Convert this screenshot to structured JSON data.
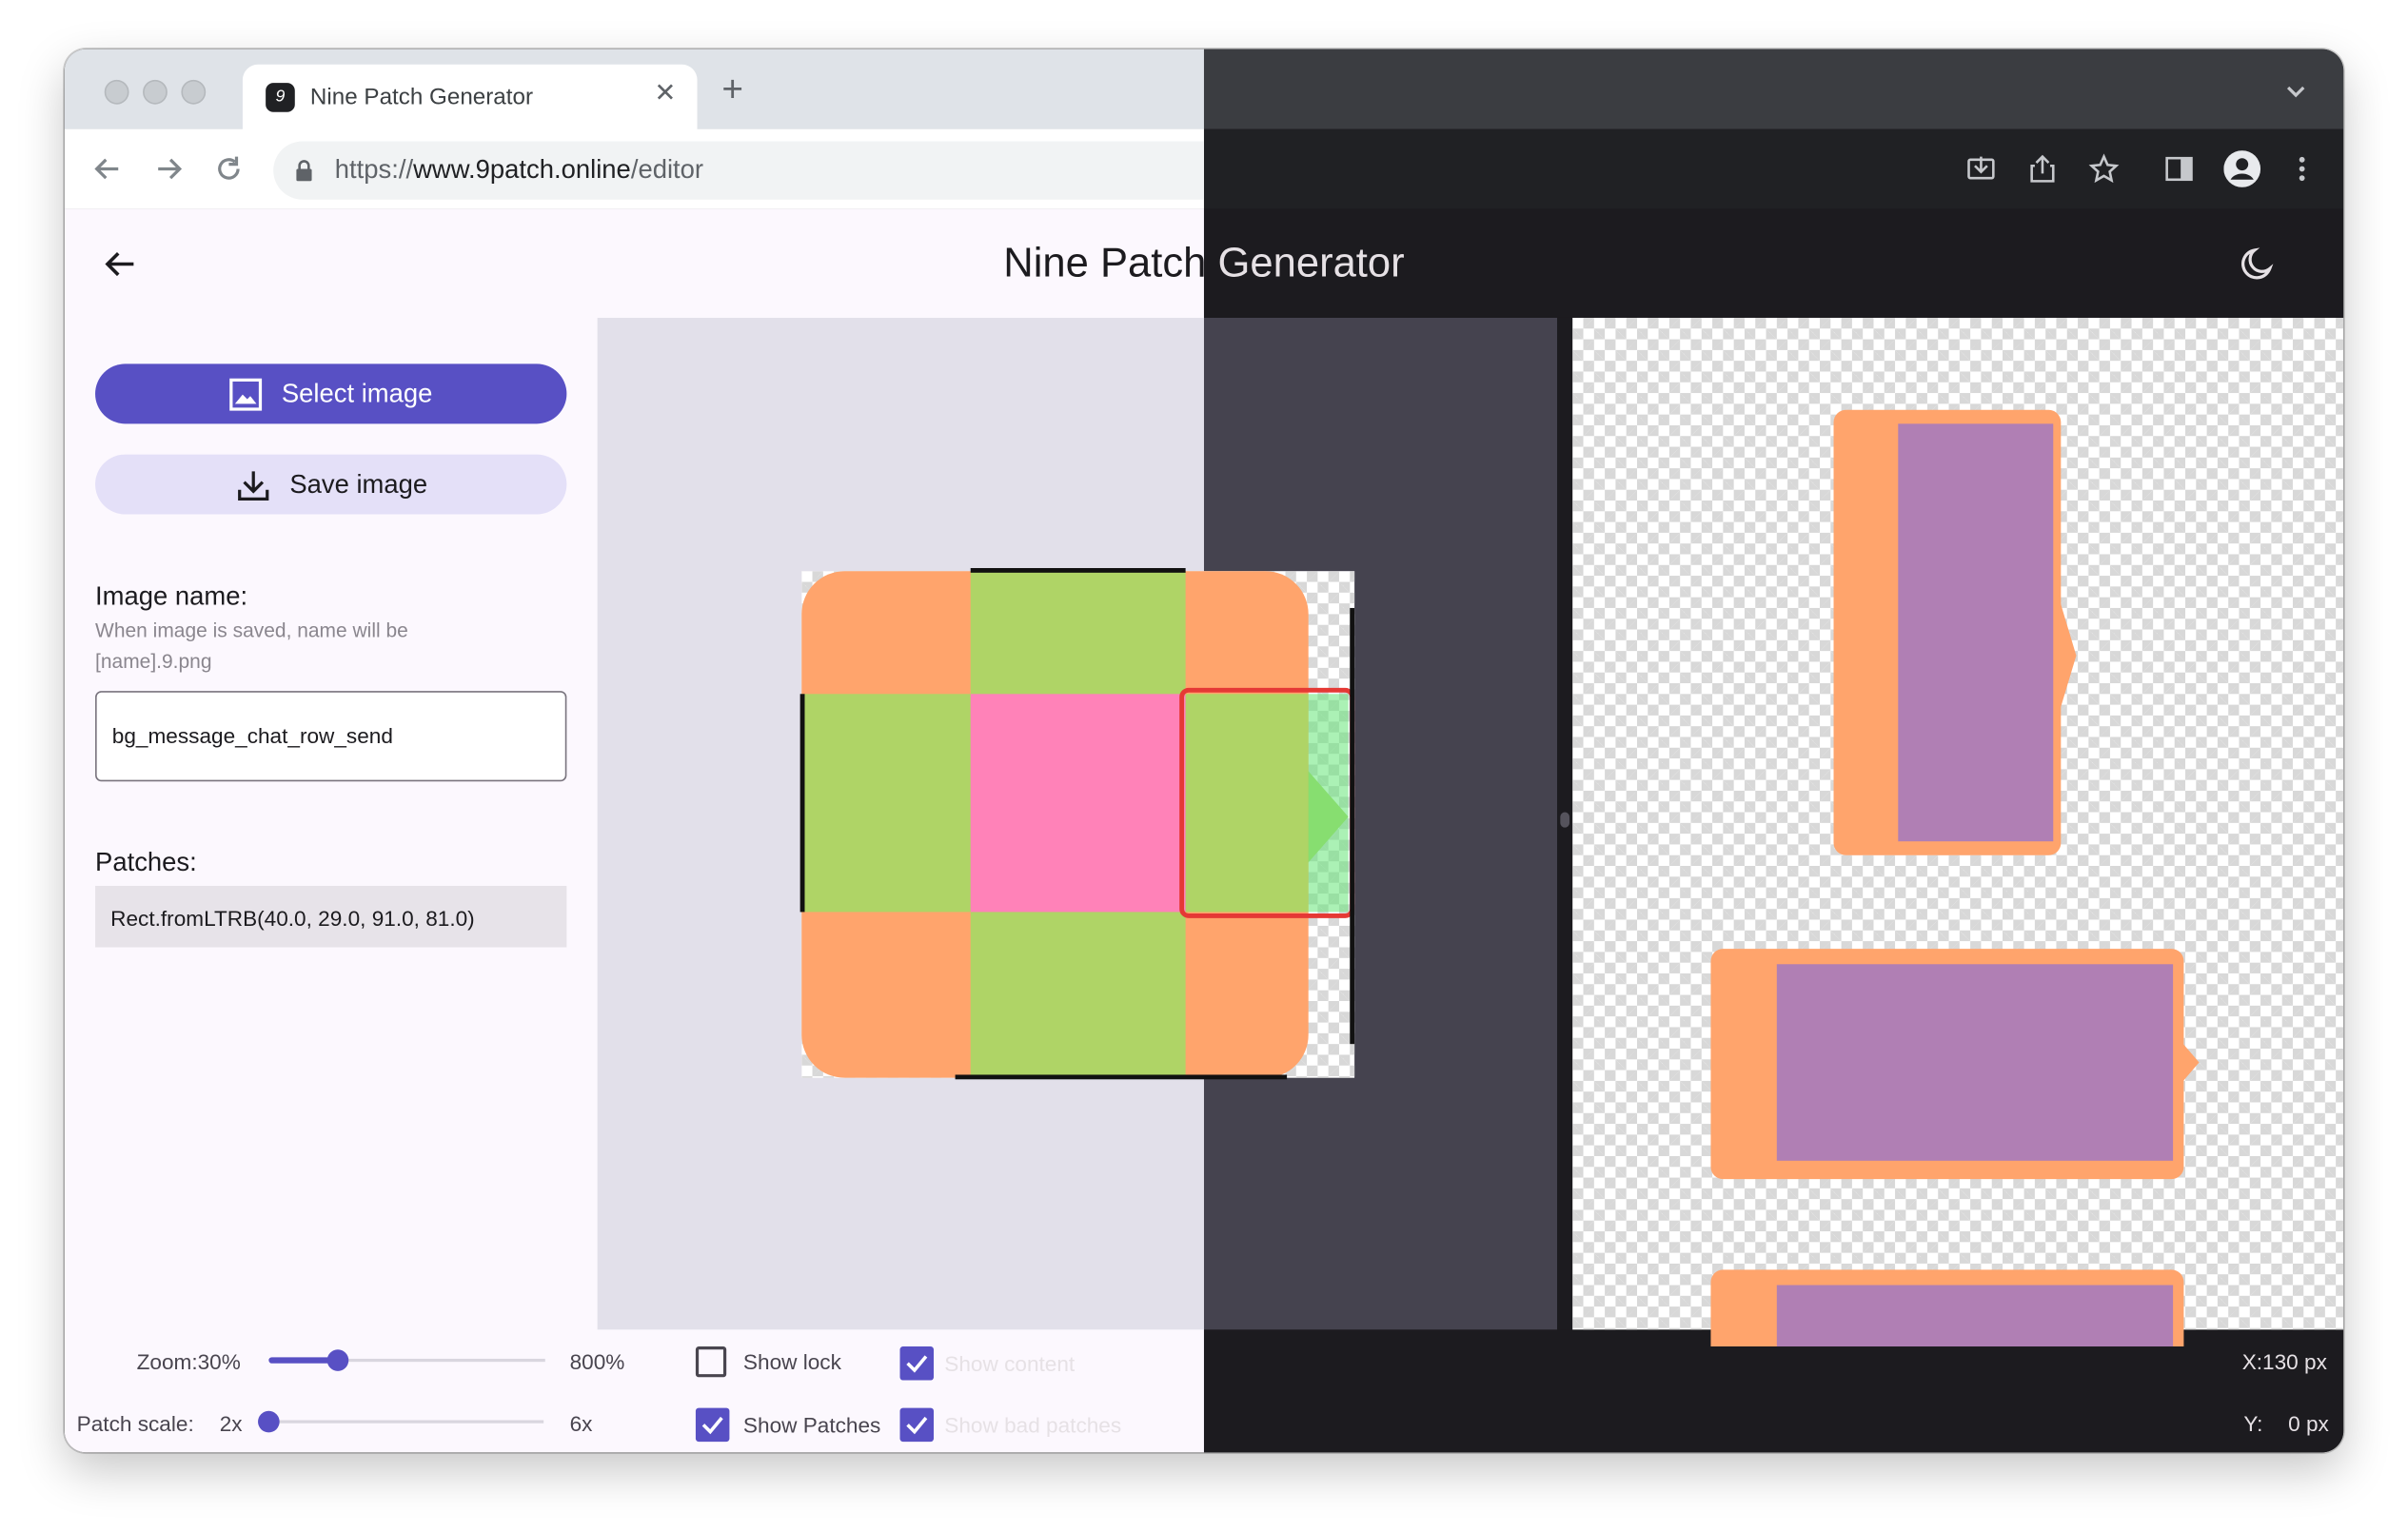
{
  "browser": {
    "tab_title": "Nine Patch Generator",
    "tab_favicon": "9",
    "url_scheme": "https://",
    "url_host": "www.9patch.online",
    "url_path": "/editor"
  },
  "app": {
    "title": "Nine Patch Generator",
    "theme_toggle_icon": "moon-icon"
  },
  "sidebar": {
    "select_image_label": "Select image",
    "save_image_label": "Save image",
    "image_name_label": "Image name:",
    "image_name_hint": "When image is saved, name will be [name].9.png",
    "image_name_value": "bg_message_chat_row_send",
    "patches_label": "Patches:",
    "patches_value": "Rect.fromLTRB(40.0, 29.0, 91.0, 81.0)"
  },
  "controls": {
    "zoom_label": "Zoom:30%",
    "zoom_max_label": "800%",
    "zoom_fraction": 0.25,
    "patch_scale_label": "Patch scale:",
    "patch_scale_value": "2x",
    "patch_scale_max": "6x",
    "patch_scale_fraction": 0.0,
    "show_lock_label": "Show lock",
    "show_lock_checked": false,
    "show_content_label": "Show content",
    "show_content_checked": true,
    "show_patches_label": "Show Patches",
    "show_patches_checked": true,
    "show_bad_patches_label": "Show bad patches",
    "show_bad_patches_checked": true
  },
  "status": {
    "x_label": "X:130 px",
    "y_label": "Y:",
    "y_value": "0 px"
  },
  "colors": {
    "accent": "#5850c4",
    "corner_patch": "#ffa46c",
    "edge_patch": "#afd466",
    "center_patch": "#ff82b8",
    "bad_patch_outline": "#e53935",
    "content_area": "#b07fb4"
  }
}
